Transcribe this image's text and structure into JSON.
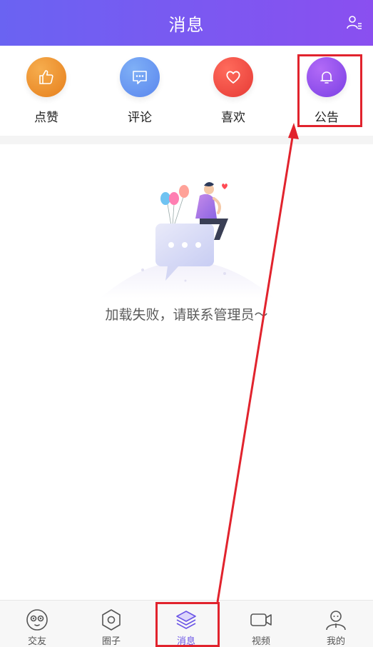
{
  "header": {
    "title": "消息",
    "user_icon": "user-list-icon"
  },
  "actions": [
    {
      "label": "点赞",
      "icon": "thumbs-up-icon",
      "color": "#f18b2c"
    },
    {
      "label": "评论",
      "icon": "comment-icon",
      "color": "#5b8ff2"
    },
    {
      "label": "喜欢",
      "icon": "heart-icon",
      "color": "#f04a3f"
    },
    {
      "label": "公告",
      "icon": "bell-icon",
      "color": "#8a4ff0"
    }
  ],
  "empty_state": {
    "message": "加载失败，请联系管理员～"
  },
  "bottom_nav": [
    {
      "label": "交友",
      "icon": "friends-icon"
    },
    {
      "label": "圈子",
      "icon": "circle-icon"
    },
    {
      "label": "消息",
      "icon": "message-layers-icon",
      "active": true
    },
    {
      "label": "视频",
      "icon": "video-icon"
    },
    {
      "label": "我的",
      "icon": "profile-icon"
    }
  ],
  "colors": {
    "header_start": "#6a63f2",
    "header_end": "#8a4ff0",
    "annotation": "#e1232d",
    "active_nav": "#6b55e6"
  }
}
